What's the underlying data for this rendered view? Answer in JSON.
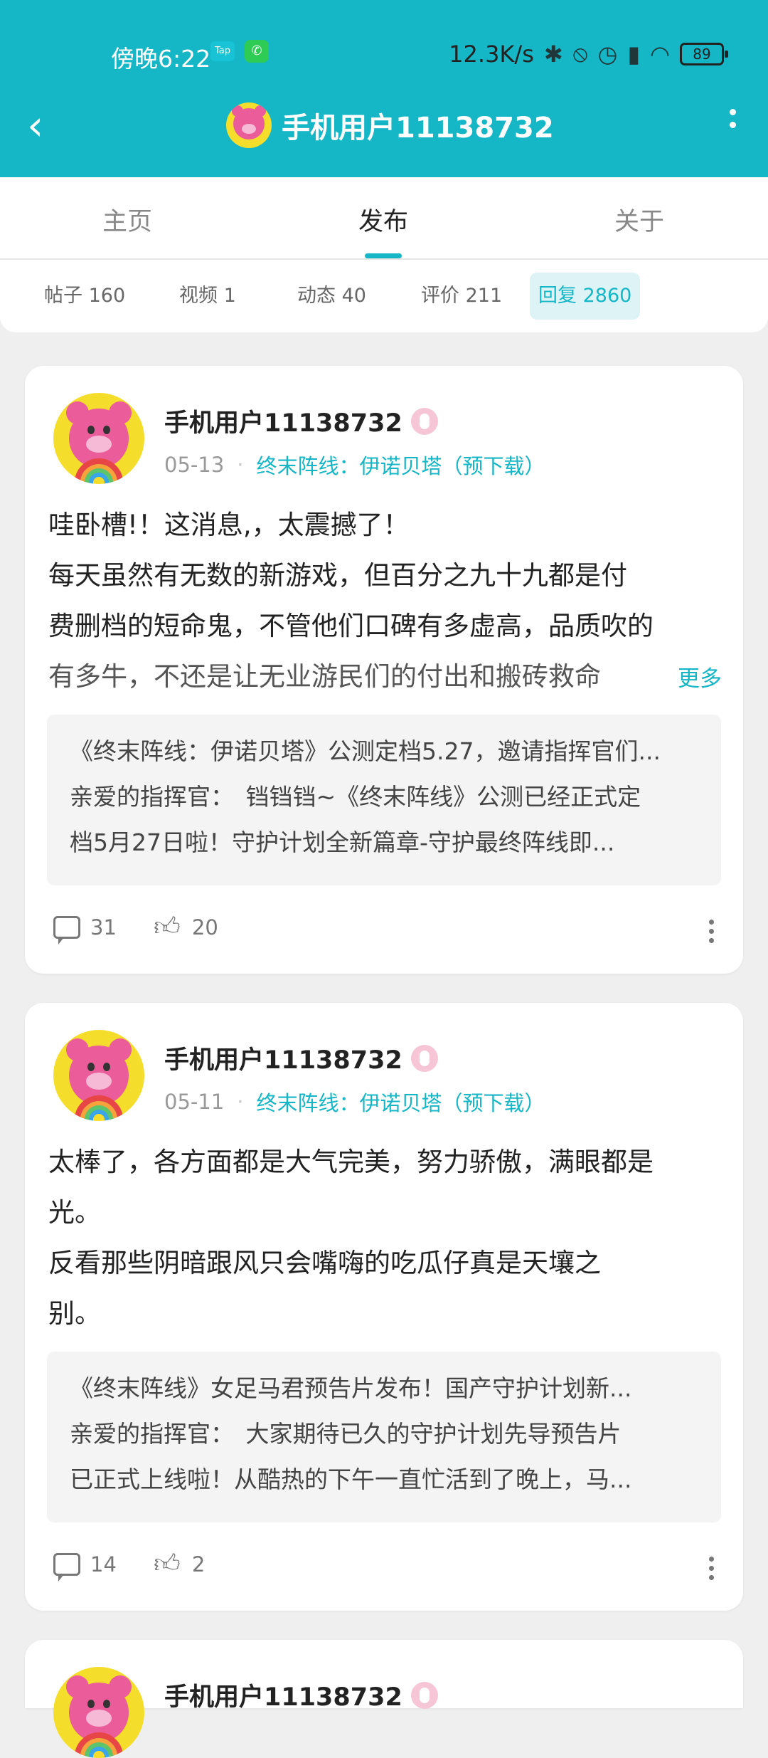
{
  "status_bar": {
    "time": "傍晚6:22",
    "app_badge": "Tap",
    "network_speed": "12.3K/s",
    "battery": "89"
  },
  "nav": {
    "title": "手机用户11138732"
  },
  "tabs": [
    {
      "label": "主页",
      "active": false
    },
    {
      "label": "发布",
      "active": true
    },
    {
      "label": "关于",
      "active": false
    }
  ],
  "filters": [
    {
      "label": "帖子 160",
      "active": false
    },
    {
      "label": "视频 1",
      "active": false
    },
    {
      "label": "动态 40",
      "active": false
    },
    {
      "label": "评价 211",
      "active": false
    },
    {
      "label": "回复 2860",
      "active": true
    }
  ],
  "posts": [
    {
      "author": "手机用户11138732",
      "date": "05-13",
      "game": "终末阵线：伊诺贝塔（预下载）",
      "lines": [
        "哇卧槽!！这消息,，太震撼了！",
        "每天虽然有无数的新游戏，但百分之九十九都是付",
        "费删档的短命鬼，不管他们口碑有多虚高，品质吹的",
        "有多牛，不还是让无业游民们的付出和搬砖救命"
      ],
      "more_label": "更多",
      "quote_title": "《终末阵线：伊诺贝塔》公测定档5.27，邀请指挥官们...",
      "quote_line1": "亲爱的指挥官：　铛铛铛~《终末阵线》公测已经正式定",
      "quote_line2": "档5月27日啦！守护计划全新篇章-守护最终阵线即...",
      "comments": "31",
      "likes": "20"
    },
    {
      "author": "手机用户11138732",
      "date": "05-11",
      "game": "终末阵线：伊诺贝塔（预下载）",
      "lines": [
        "太棒了，各方面都是大气完美，努力骄傲，满眼都是",
        "光。",
        "反看那些阴暗跟风只会嘴嗨的吃瓜仔真是天壤之",
        "别。"
      ],
      "quote_title": "《终末阵线》女足马君预告片发布！国产守护计划新...",
      "quote_line1": "亲爱的指挥官：　大家期待已久的守护计划先导预告片",
      "quote_line2": "已正式上线啦！从酷热的下午一直忙活到了晚上，马...",
      "comments": "14",
      "likes": "2"
    },
    {
      "author": "手机用户11138732"
    }
  ],
  "colors": {
    "accent": "#15b6c6",
    "background": "#efefef"
  }
}
